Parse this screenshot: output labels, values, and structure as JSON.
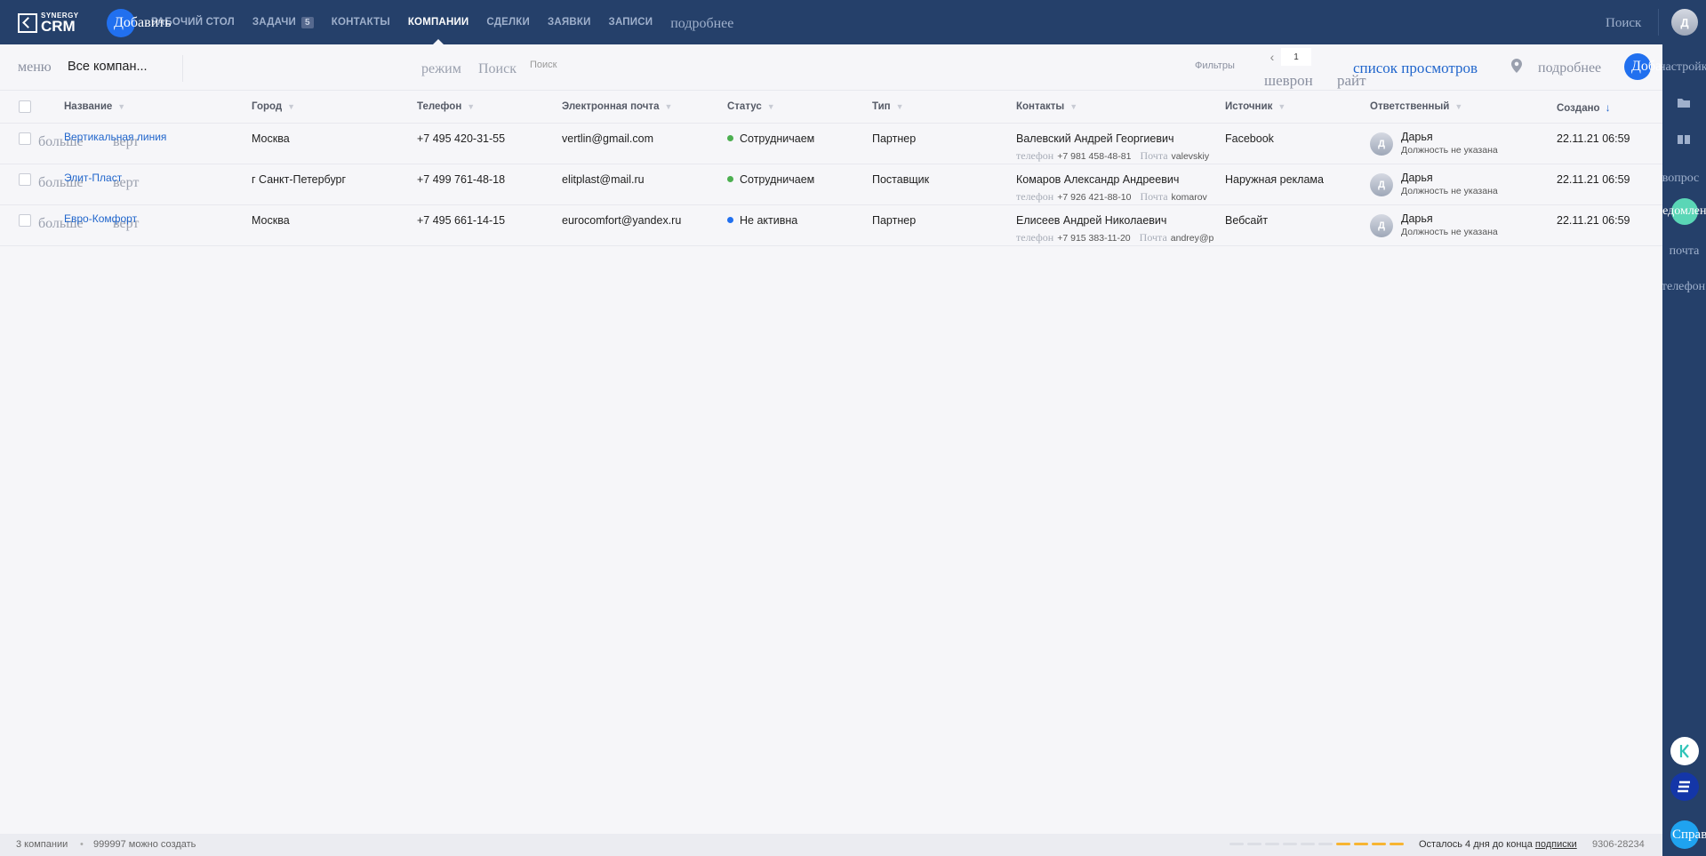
{
  "header": {
    "logo_small": "SYNERGY",
    "logo_big": "CRM",
    "add_label": "Добавить",
    "nav": [
      {
        "label": "РАБОЧИЙ СТОЛ",
        "active": false
      },
      {
        "label": "ЗАДАЧИ",
        "badge": "5",
        "active": false
      },
      {
        "label": "КОНТАКТЫ",
        "active": false
      },
      {
        "label": "КОМПАНИИ",
        "active": true
      },
      {
        "label": "СДЕЛКИ",
        "active": false
      },
      {
        "label": "ЗАЯВКИ",
        "active": false
      },
      {
        "label": "ЗАПИСИ",
        "active": false
      }
    ],
    "more_label": "подробнее",
    "search_label": "Поиск",
    "avatar_letter": "Д"
  },
  "toolbar": {
    "menu_label": "меню",
    "view_name": "Все компан...",
    "mode_label": "режим",
    "search_icon_label": "Поиск",
    "search_placeholder": "Поиск",
    "filters_label": "Фильтры",
    "page": "1",
    "chevron_label": "шеврон",
    "right_label": "райт",
    "views_list_label": "список просмотров",
    "more_label": "подробнее",
    "add_label": "Добавить"
  },
  "table": {
    "columns": {
      "name": "Название",
      "city": "Город",
      "phone": "Телефон",
      "email": "Электронная почта",
      "status": "Статус",
      "type": "Тип",
      "contacts": "Контакты",
      "source": "Источник",
      "responsible": "Ответственный",
      "created": "Создано"
    },
    "row_more_label": "больше",
    "row_vert_label": "верт",
    "contact_phone_label": "телефон",
    "contact_mail_label": "Почта",
    "rows": [
      {
        "name": "Вертикальная линия",
        "city": "Москва",
        "phone": "+7 495 420-31-55",
        "email": "vertlin@gmail.com",
        "status": "Сотрудничаем",
        "status_color": "#4caf50",
        "type": "Партнер",
        "contact_name": "Валевский Андрей Георгиевич",
        "contact_phone": "+7 981 458-48-81",
        "contact_mail": "valevskiy",
        "source": "Facebook",
        "resp_letter": "Д",
        "resp_name": "Дарья",
        "resp_position": "Должность не указана",
        "created": "22.11.21 06:59"
      },
      {
        "name": "Элит-Пласт",
        "city": "г Санкт-Петербург",
        "phone": "+7 499 761-48-18",
        "email": "elitplast@mail.ru",
        "status": "Сотрудничаем",
        "status_color": "#4caf50",
        "type": "Поставщик",
        "contact_name": "Комаров Александр Андреевич",
        "contact_phone": "+7 926 421-88-10",
        "contact_mail": "komarov",
        "source": "Наружная реклама",
        "resp_letter": "Д",
        "resp_name": "Дарья",
        "resp_position": "Должность не указана",
        "created": "22.11.21 06:59"
      },
      {
        "name": "Евро-Комфорт",
        "city": "Москва",
        "phone": "+7 495 661-14-15",
        "email": "eurocomfort@yandex.ru",
        "status": "Не активна",
        "status_color": "#2170ef",
        "type": "Партнер",
        "contact_name": "Елисеев Андрей Николаевич",
        "contact_phone": "+7 915 383-11-20",
        "contact_mail": "andrey@p",
        "source": "Вебсайт",
        "resp_letter": "Д",
        "resp_name": "Дарья",
        "resp_position": "Должность не указана",
        "created": "22.11.21 06:59"
      }
    ]
  },
  "sidebar": {
    "settings_label": "настройки",
    "question_label": "вопрос",
    "notifications_label": "уведомления",
    "mail_label": "почта",
    "phone_label": "телефон",
    "help_label": "Справка"
  },
  "footer": {
    "count": "3 компании",
    "can_create": "999997 можно создать",
    "days_left_prefix": "Осталось 4 дня до конца",
    "subscription_link": "подписки",
    "account_number": "9306-28234",
    "progress_total": 10,
    "progress_filled": 4
  },
  "colors": {
    "nav_bg": "#25406a",
    "accent": "#2170ef",
    "link": "#2166cc",
    "status_active": "#4caf50",
    "status_inactive": "#2170ef",
    "progress_on": "#f7b532"
  }
}
